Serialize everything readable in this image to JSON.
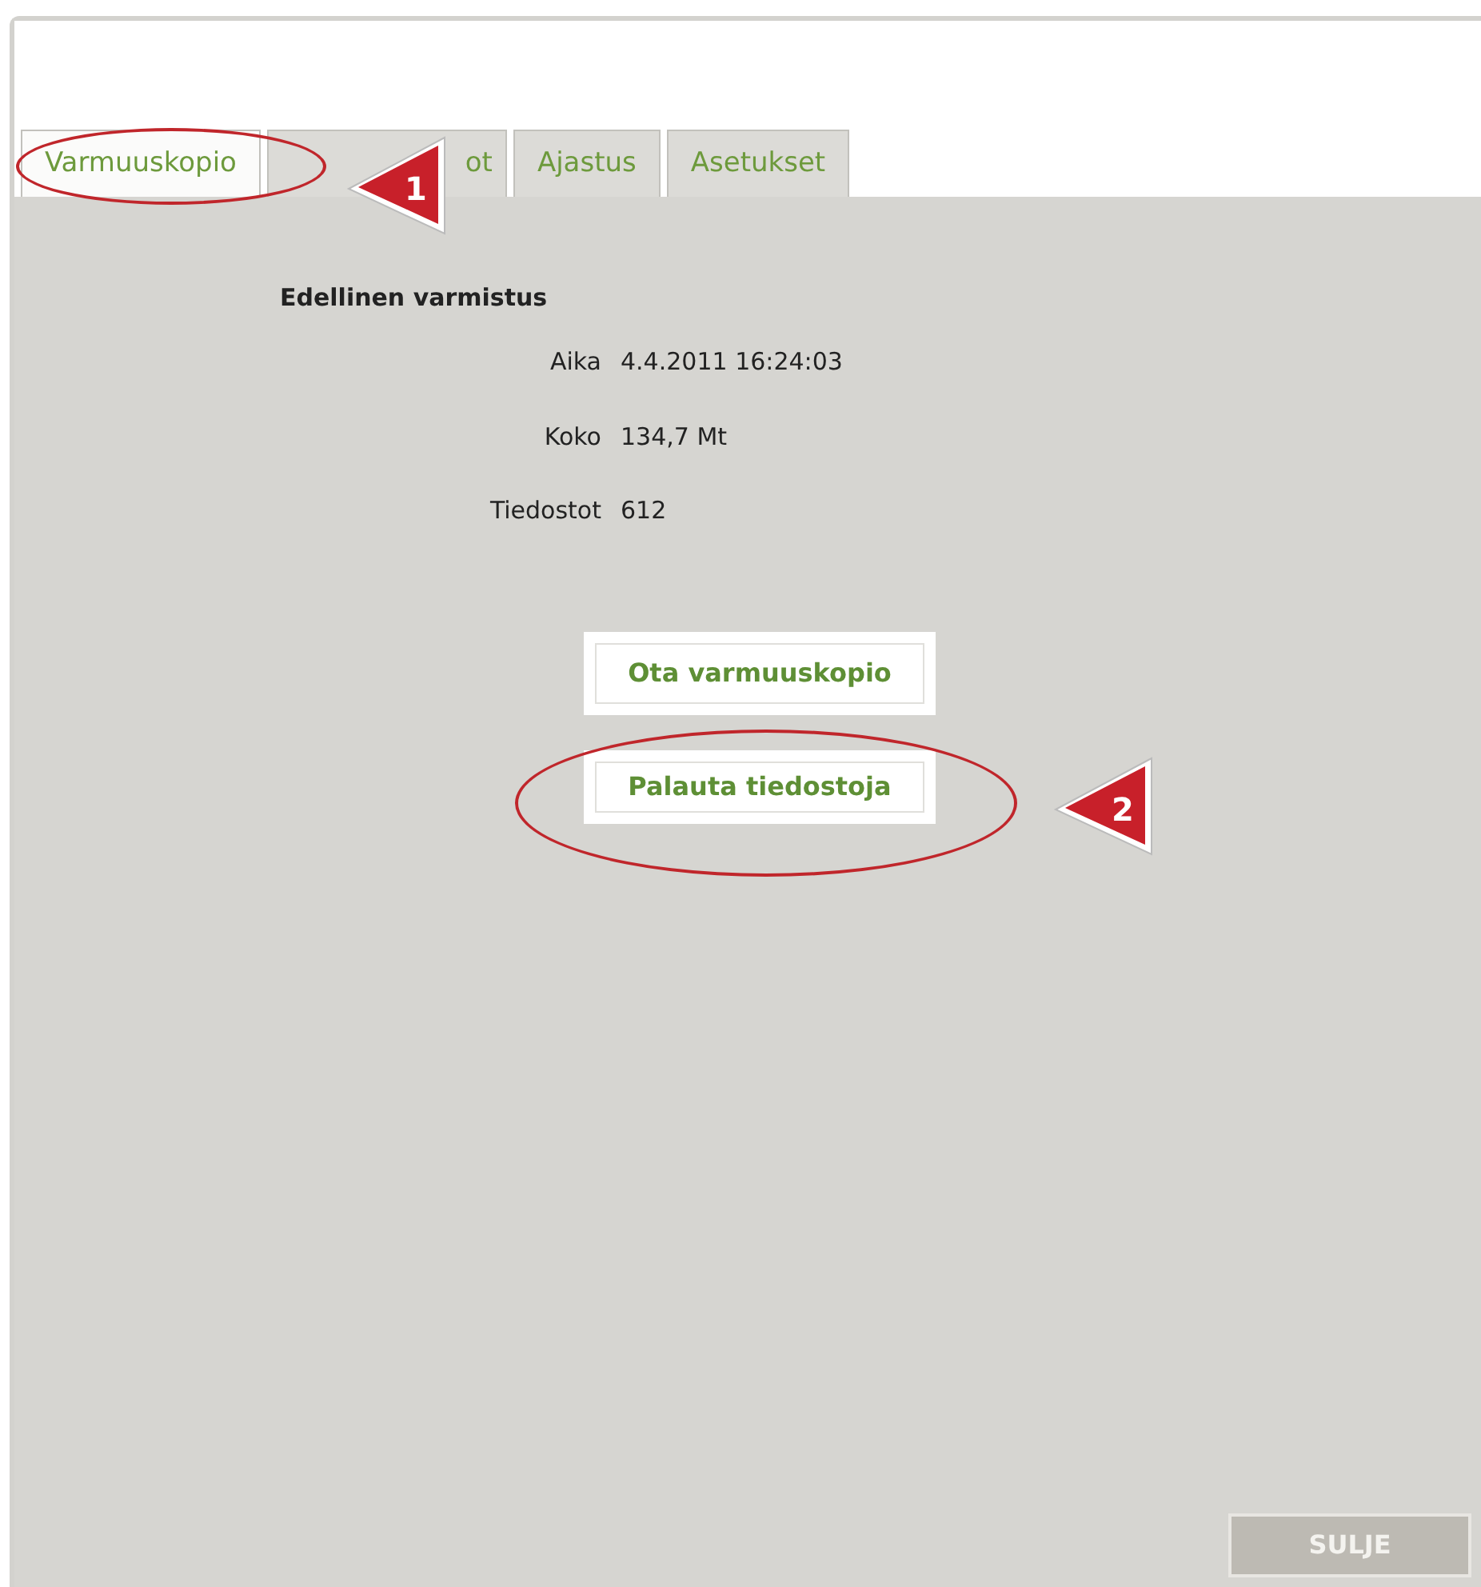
{
  "tabs": [
    {
      "label": "Varmuuskopio",
      "selected": true
    },
    {
      "label": "ot",
      "selected": false
    },
    {
      "label": "Ajastus",
      "selected": false
    },
    {
      "label": "Asetukset",
      "selected": false
    }
  ],
  "section_title": "Edellinen varmistus",
  "details": [
    {
      "label": "Aika",
      "value": "4.4.2011 16:24:03"
    },
    {
      "label": "Koko",
      "value": "134,7 Mt"
    },
    {
      "label": "Tiedostot",
      "value": "612"
    }
  ],
  "actions": [
    "Ota varmuuskopio",
    "Palauta tiedostoja"
  ],
  "close_button": "SULJE",
  "callouts": [
    {
      "number": "1"
    },
    {
      "number": "2"
    }
  ]
}
